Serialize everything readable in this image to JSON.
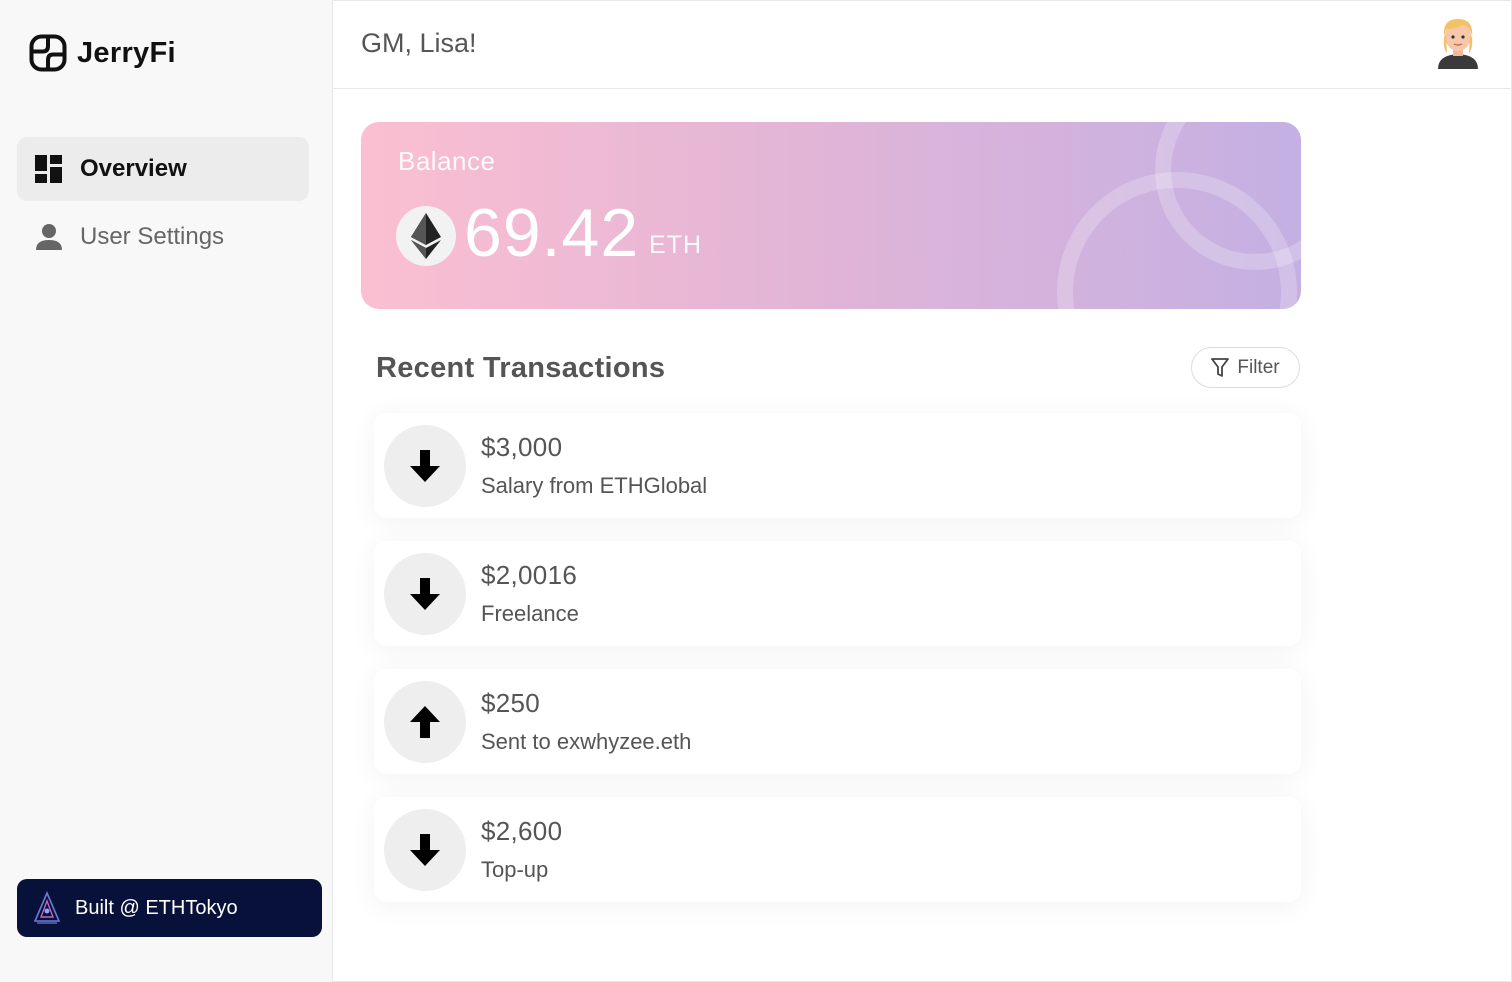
{
  "brand": {
    "name": "JerryFi",
    "icon": "jerryfi-logo-icon"
  },
  "sidebar": {
    "items": [
      {
        "label": "Overview",
        "icon": "dashboard-icon",
        "active": true
      },
      {
        "label": "User Settings",
        "icon": "user-icon",
        "active": false
      }
    ],
    "footer_badge": {
      "label": "Built @ ETHTokyo",
      "icon": "ethtokyo-logo-icon"
    }
  },
  "header": {
    "greeting": "GM, Lisa!",
    "avatar": "user-avatar"
  },
  "balance": {
    "label": "Balance",
    "value": "69.42",
    "unit": "ETH",
    "icon": "ethereum-icon"
  },
  "transactions": {
    "title": "Recent Transactions",
    "filter_label": "Filter",
    "filter_icon": "filter-icon",
    "items": [
      {
        "amount": "$3,000",
        "description": "Salary from ETHGlobal",
        "direction": "in",
        "icon": "arrow-down-icon"
      },
      {
        "amount": "$2,0016",
        "description": "Freelance",
        "direction": "in",
        "icon": "arrow-down-icon"
      },
      {
        "amount": "$250",
        "description": "Sent to exwhyzee.eth",
        "direction": "out",
        "icon": "arrow-up-icon"
      },
      {
        "amount": "$2,600",
        "description": "Top-up",
        "direction": "in",
        "icon": "arrow-down-icon"
      }
    ]
  },
  "colors": {
    "sidebar_bg": "#f8f8f8",
    "active_nav_bg": "#ececec",
    "badge_bg": "#07113a",
    "balance_gradient_start": "#fbbfd1",
    "balance_gradient_end": "#c4b0e3"
  }
}
